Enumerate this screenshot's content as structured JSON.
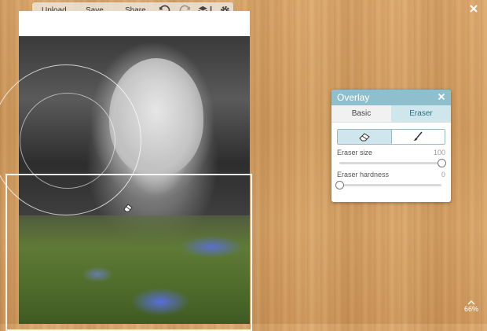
{
  "toolbar": {
    "upload": "Upload",
    "save": "Save",
    "share": "Share",
    "icons": [
      "undo-icon",
      "redo-icon",
      "layers-icon",
      "settings-icon"
    ]
  },
  "overlay_panel": {
    "title": "Overlay",
    "tabs": [
      {
        "label": "Basic",
        "active": false
      },
      {
        "label": "Eraser",
        "active": true
      }
    ],
    "tools": [
      {
        "name": "eraser-tool",
        "active": true
      },
      {
        "name": "brush-tool",
        "active": false
      }
    ],
    "sliders": [
      {
        "label": "Eraser size",
        "value": "100",
        "fraction": 1.0
      },
      {
        "label": "Eraser hardness",
        "value": "0",
        "fraction": 0.0
      }
    ]
  },
  "zoom": {
    "level": "66%"
  },
  "colors": {
    "panel_header": "#8fbfcc",
    "active_tab": "#cfe6ec",
    "desk": "#d29d60"
  }
}
